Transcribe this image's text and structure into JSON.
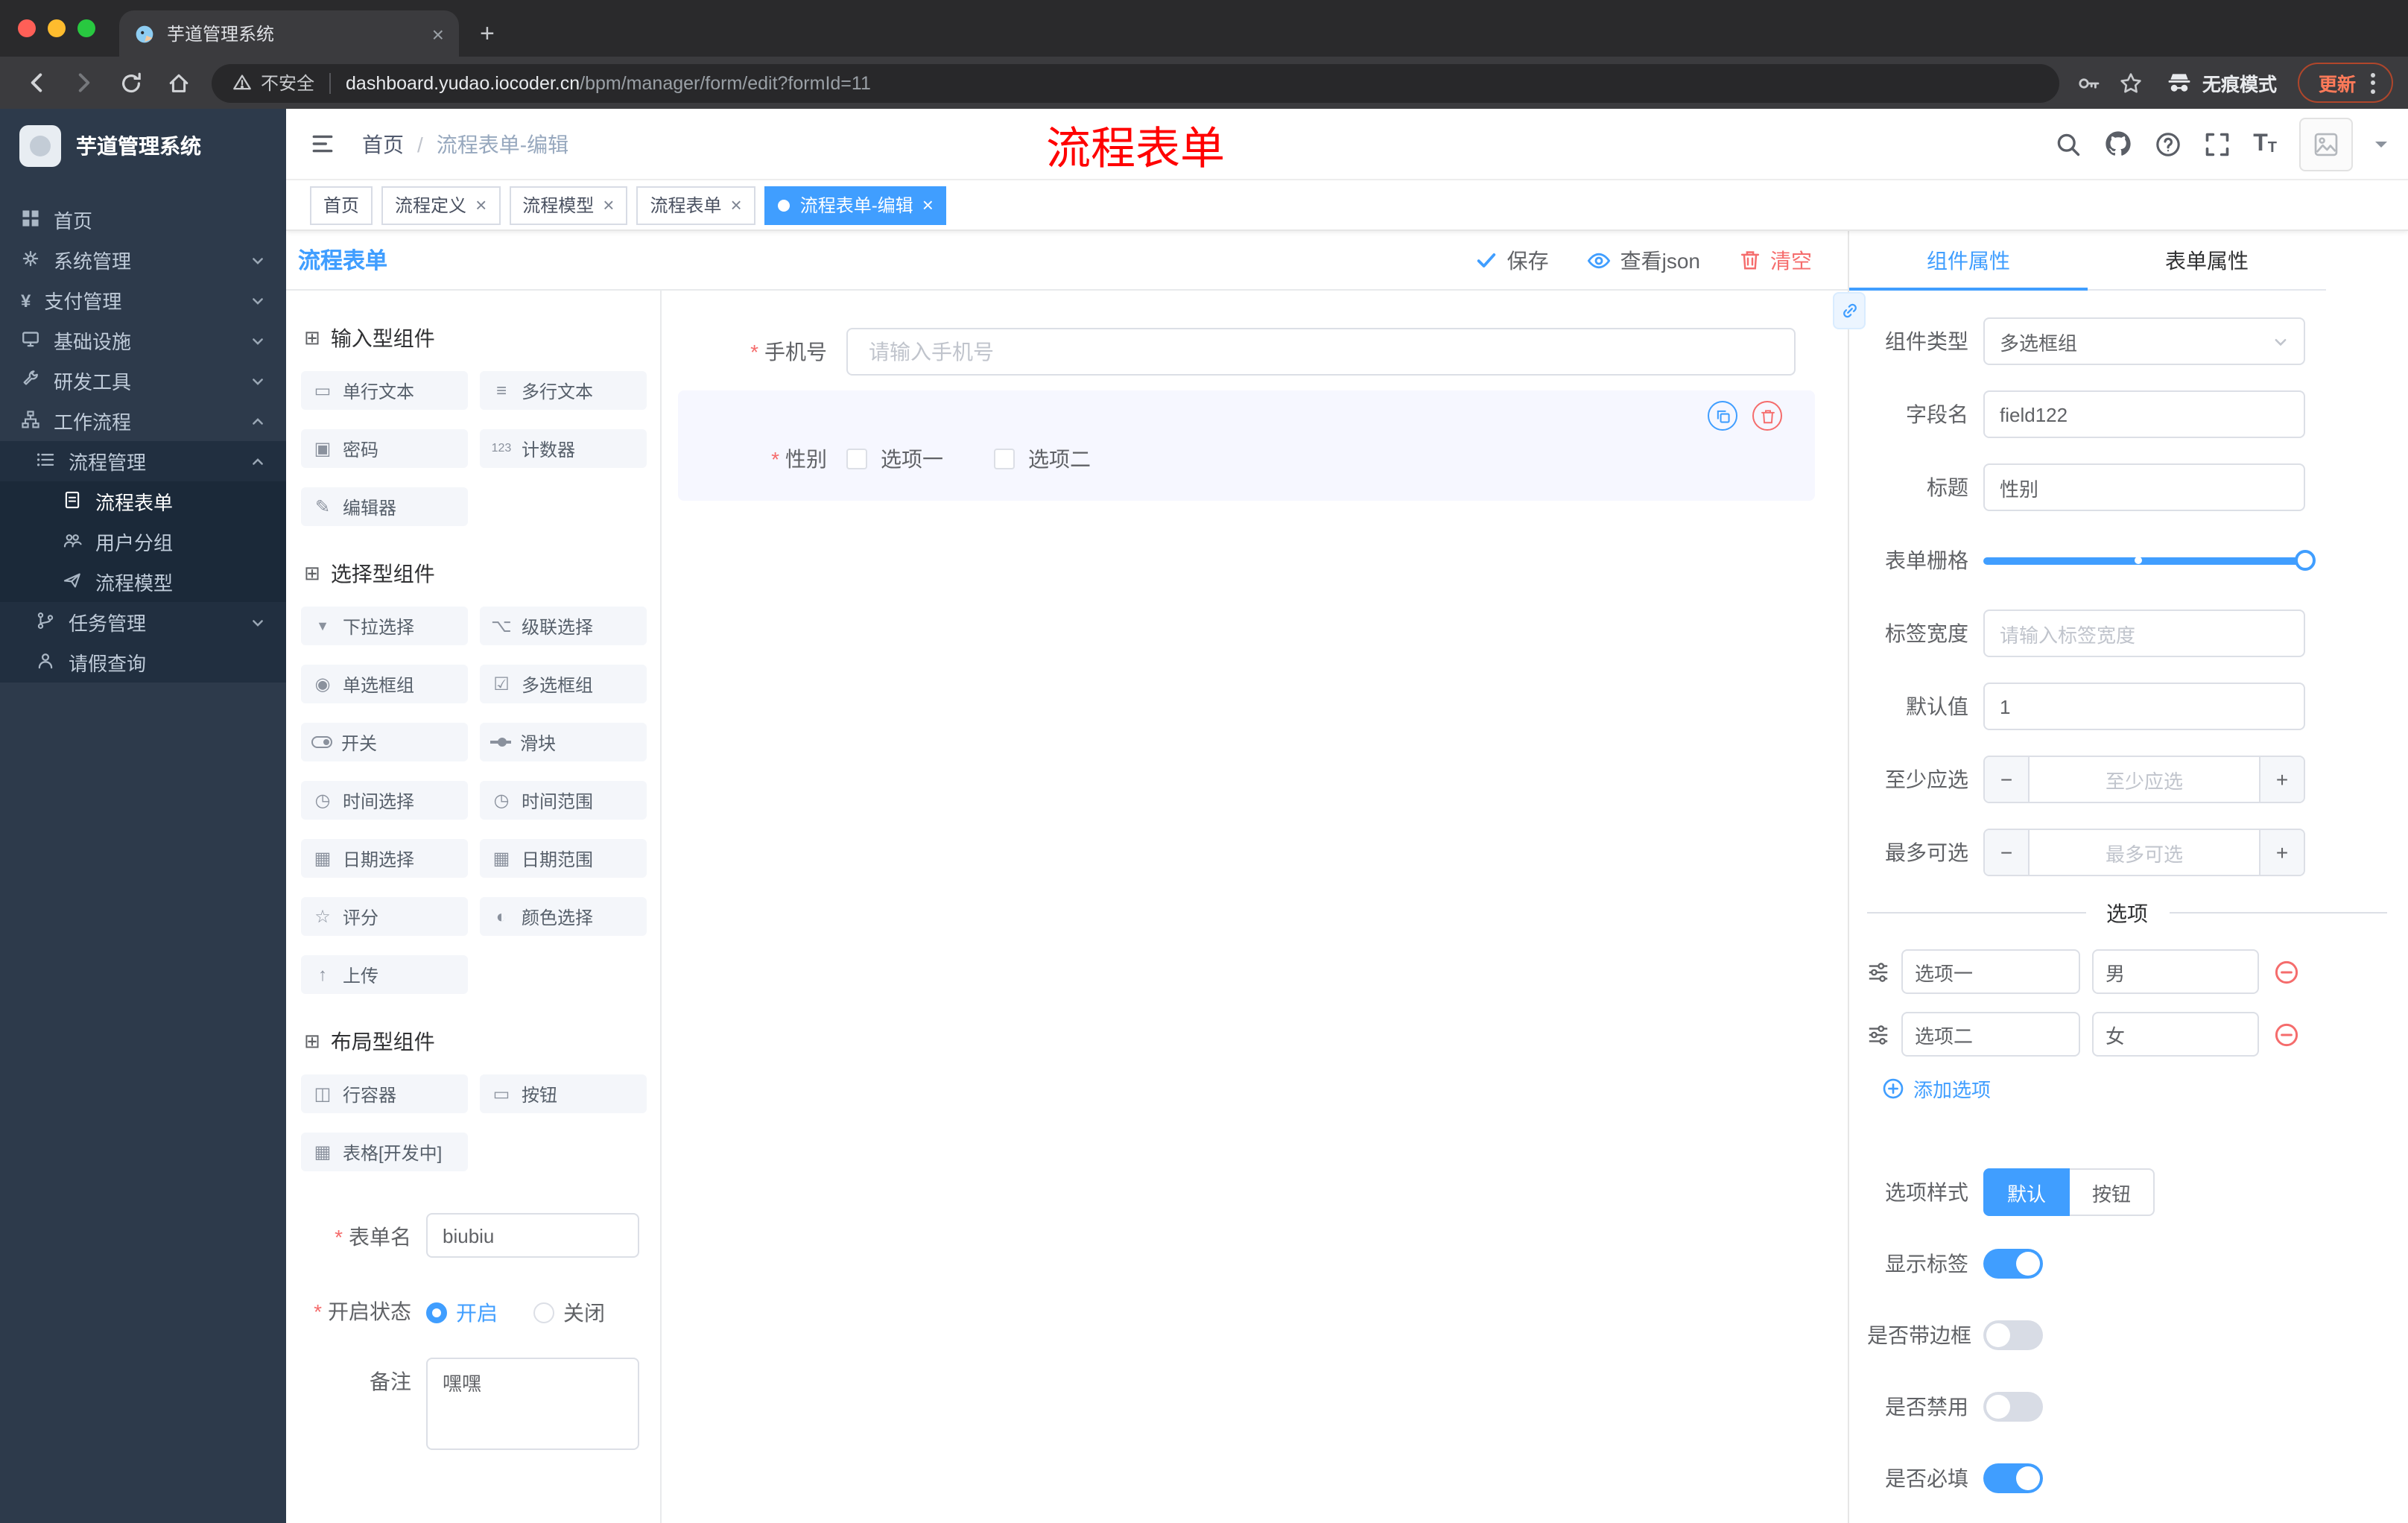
{
  "browser": {
    "tab_title": "芋道管理系统",
    "close_tab": "×",
    "new_tab": "+",
    "security_label": "不安全",
    "url_host": "dashboard.yudao.iocoder.cn",
    "url_path": "/bpm/manager/form/edit?formId=11",
    "incognito_label": "无痕模式",
    "update_label": "更新"
  },
  "sidebar": {
    "logo_title": "芋道管理系统",
    "items": [
      {
        "label": "首页",
        "icon": "dashboard-icon"
      },
      {
        "label": "系统管理",
        "icon": "gear-icon",
        "chevron": "down"
      },
      {
        "label": "支付管理",
        "icon": "payment-icon",
        "chevron": "down"
      },
      {
        "label": "基础设施",
        "icon": "infrastructure-icon",
        "chevron": "down"
      },
      {
        "label": "研发工具",
        "icon": "tools-icon",
        "chevron": "down"
      },
      {
        "label": "工作流程",
        "icon": "workflow-icon",
        "chevron": "up"
      },
      {
        "label": "流程管理",
        "icon": "process-list-icon",
        "chevron": "up",
        "level": 2
      },
      {
        "label": "流程表单",
        "icon": "form-doc-icon",
        "level": 3,
        "active": true
      },
      {
        "label": "用户分组",
        "icon": "user-group-icon",
        "level": 3
      },
      {
        "label": "流程模型",
        "icon": "model-plane-icon",
        "level": 3
      },
      {
        "label": "任务管理",
        "icon": "task-branch-icon",
        "chevron": "down",
        "level": 2
      },
      {
        "label": "请假查询",
        "icon": "person-icon",
        "level": 2
      }
    ]
  },
  "header": {
    "breadcrumb_home": "首页",
    "breadcrumb_sep": "/",
    "breadcrumb_current": "流程表单-编辑",
    "annotation": "流程表单",
    "annotation_color": "#ff0000"
  },
  "tags": {
    "items": [
      {
        "label": "首页",
        "closable": false,
        "active": false
      },
      {
        "label": "流程定义",
        "closable": true,
        "active": false
      },
      {
        "label": "流程模型",
        "closable": true,
        "active": false
      },
      {
        "label": "流程表单",
        "closable": true,
        "active": false
      },
      {
        "label": "流程表单-编辑",
        "closable": true,
        "active": true
      }
    ],
    "close_glyph": "×"
  },
  "designer": {
    "panel_title": "流程表单",
    "actions": {
      "save": "保存",
      "view_json": "查看json",
      "clear": "清空"
    },
    "groups": [
      {
        "title": "输入型组件",
        "items": [
          {
            "label": "单行文本",
            "icon": "single-line-text-icon"
          },
          {
            "label": "多行文本",
            "icon": "multi-line-text-icon"
          },
          {
            "label": "密码",
            "icon": "password-icon"
          },
          {
            "label": "计数器",
            "icon": "counter-icon"
          },
          {
            "label": "编辑器",
            "icon": "editor-icon"
          }
        ]
      },
      {
        "title": "选择型组件",
        "items": [
          {
            "label": "下拉选择",
            "icon": "select-icon"
          },
          {
            "label": "级联选择",
            "icon": "cascader-icon"
          },
          {
            "label": "单选框组",
            "icon": "radio-group-icon"
          },
          {
            "label": "多选框组",
            "icon": "checkbox-group-icon"
          },
          {
            "label": "开关",
            "icon": "switch-icon"
          },
          {
            "label": "滑块",
            "icon": "slider-icon"
          },
          {
            "label": "时间选择",
            "icon": "time-icon"
          },
          {
            "label": "时间范围",
            "icon": "time-range-icon"
          },
          {
            "label": "日期选择",
            "icon": "date-icon"
          },
          {
            "label": "日期范围",
            "icon": "date-range-icon"
          },
          {
            "label": "评分",
            "icon": "rate-star-icon"
          },
          {
            "label": "颜色选择",
            "icon": "color-icon"
          },
          {
            "label": "上传",
            "icon": "upload-icon"
          }
        ]
      },
      {
        "title": "布局型组件",
        "items": [
          {
            "label": "行容器",
            "icon": "row-container-icon"
          },
          {
            "label": "按钮",
            "icon": "button-icon"
          },
          {
            "label": "表格[开发中]",
            "icon": "table-icon"
          }
        ]
      }
    ],
    "meta": {
      "name_label": "表单名",
      "name_value": "biubiu",
      "status_label": "开启状态",
      "status_on": "开启",
      "status_off": "关闭",
      "status_value": "开启",
      "remark_label": "备注",
      "remark_value": "嘿嘿"
    },
    "canvas": {
      "phone_label": "手机号",
      "phone_placeholder": "请输入手机号",
      "gender_label": "性别",
      "gender_options": [
        "选项一",
        "选项二"
      ]
    }
  },
  "props": {
    "tabs": [
      "组件属性",
      "表单属性"
    ],
    "active_tab": "组件属性",
    "component_type_label": "组件类型",
    "component_type_value": "多选框组",
    "field_name_label": "字段名",
    "field_name_value": "field122",
    "title_label": "标题",
    "title_value": "性别",
    "grid_label": "表单栅格",
    "label_width_label": "标签宽度",
    "label_width_placeholder": "请输入标签宽度",
    "default_label": "默认值",
    "default_value": "1",
    "min_label": "至少应选",
    "min_placeholder": "至少应选",
    "max_label": "最多可选",
    "max_placeholder": "最多可选",
    "minus_glyph": "−",
    "plus_glyph": "+",
    "options_title": "选项",
    "options": [
      {
        "label": "选项一",
        "value": "男"
      },
      {
        "label": "选项二",
        "value": "女"
      }
    ],
    "add_option": "添加选项",
    "style_label": "选项样式",
    "style_options": [
      "默认",
      "按钮"
    ],
    "style_value": "默认",
    "switches": [
      {
        "label": "显示标签",
        "on": true
      },
      {
        "label": "是否带边框",
        "on": false
      },
      {
        "label": "是否禁用",
        "on": false
      },
      {
        "label": "是否必填",
        "on": true
      }
    ]
  },
  "colors": {
    "accent": "#409eff",
    "danger": "#f56c6c",
    "sidebar": "#2d3a4b",
    "active_tag": "#409eff"
  }
}
